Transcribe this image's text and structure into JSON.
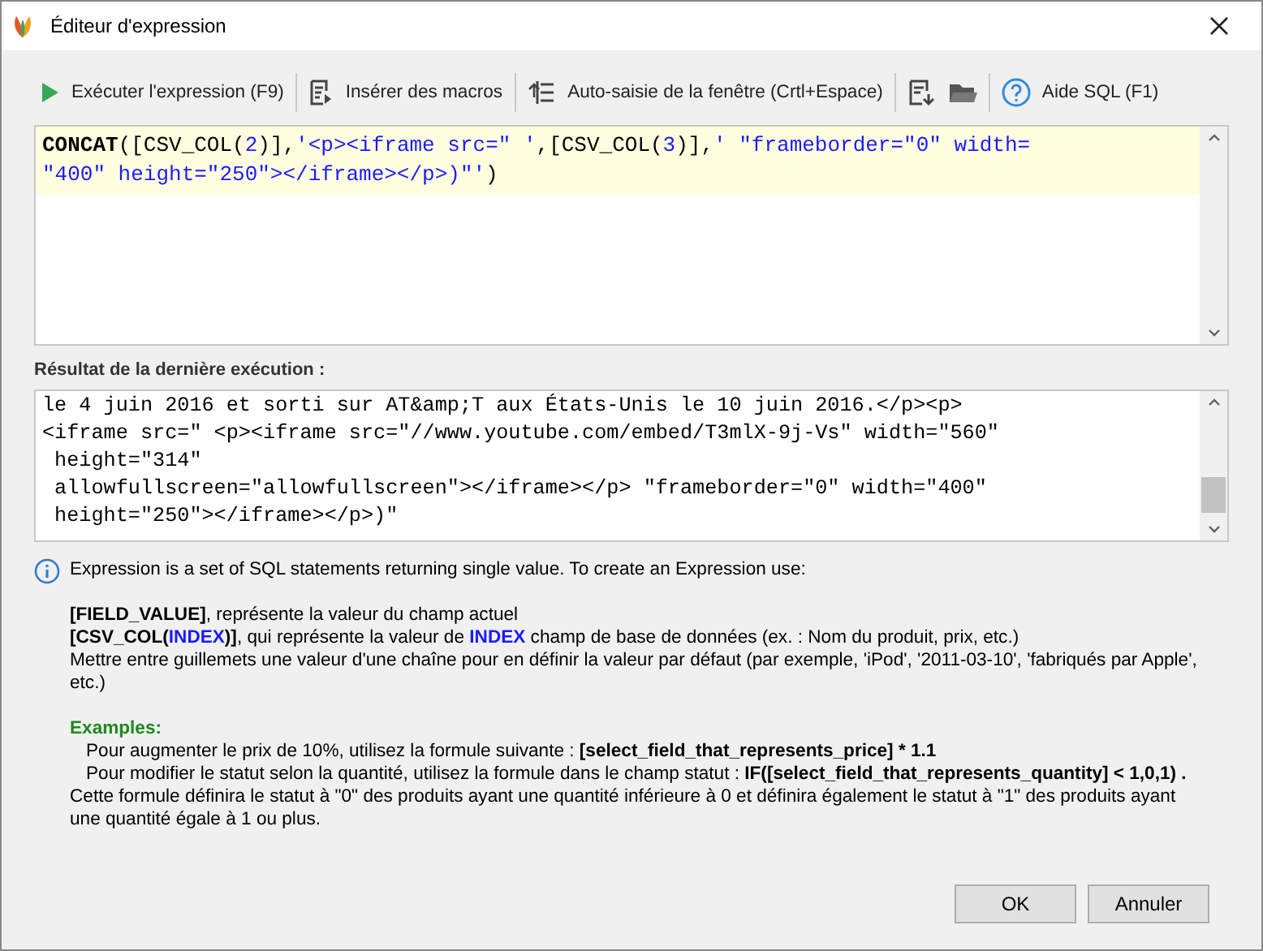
{
  "window": {
    "title": "Éditeur d'expression"
  },
  "toolbar": [
    {
      "kind": "run",
      "label": "Exécuter l'expression (F9)"
    },
    {
      "kind": "macros",
      "label": "Insérer des macros"
    },
    {
      "kind": "autofill",
      "label": "Auto-saisie de la fenêtre (Crtl+Espace)"
    },
    {
      "kind": "save"
    },
    {
      "kind": "open"
    },
    {
      "kind": "help",
      "label": "Aide SQL (F1)"
    }
  ],
  "editor": {
    "lines": [
      [
        {
          "kind": "keyword",
          "text": "CONCAT"
        },
        {
          "kind": "plain",
          "text": "([CSV_COL("
        },
        {
          "kind": "number",
          "text": "2"
        },
        {
          "kind": "plain",
          "text": ")],"
        },
        {
          "kind": "string",
          "text": "'<p><iframe src=\" '"
        },
        {
          "kind": "plain",
          "text": ",[CSV_COL("
        },
        {
          "kind": "number",
          "text": "3"
        },
        {
          "kind": "plain",
          "text": ")],"
        },
        {
          "kind": "string",
          "text": "' \"frameborder=\"0\" width="
        }
      ],
      [
        {
          "kind": "string",
          "text": "\"400\" height=\"250\"></iframe></p>)\"'"
        },
        {
          "kind": "plain",
          "text": ")"
        }
      ]
    ]
  },
  "result": {
    "label": "Résultat de la dernière exécution :",
    "lines": [
      "le 4 juin 2016 et sorti sur AT&amp;T aux États-Unis le 10 juin 2016.</p><p>",
      "<iframe src=\" <p><iframe src=\"//www.youtube.com/embed/T3mlX-9j-Vs\" width=\"560\"",
      " height=\"314\"",
      " allowfullscreen=\"allowfullscreen\"></iframe></p> \"frameborder=\"0\" width=\"400\"",
      " height=\"250\"></iframe></p>)\""
    ]
  },
  "help": {
    "intro": "Expression is a set of SQL statements returning single value. To create an Expression use:",
    "lines": [
      [
        {
          "kind": "bold",
          "text": "[FIELD_VALUE]"
        },
        {
          "kind": "plain",
          "text": ", représente la valeur du champ actuel"
        }
      ],
      [
        {
          "kind": "bold",
          "text": "[CSV_COL("
        },
        {
          "kind": "accent",
          "text": "INDEX"
        },
        {
          "kind": "bold",
          "text": ")]"
        },
        {
          "kind": "plain",
          "text": ", qui représente la valeur de "
        },
        {
          "kind": "accent",
          "text": "INDEX"
        },
        {
          "kind": "plain",
          "text": " champ de base de données (ex. : Nom du produit, prix, etc.)"
        }
      ],
      [
        {
          "kind": "plain",
          "text": "Mettre entre guillemets une valeur d'une chaîne pour en définir la valeur par défaut (par exemple, 'iPod', '2011-03-10', 'fabriqués par Apple', etc.)"
        }
      ]
    ],
    "examples_title": "Examples:",
    "examples": [
      [
        {
          "kind": "plain",
          "text": "Pour augmenter le prix de 10%, utilisez la formule suivante : "
        },
        {
          "kind": "bold",
          "text": "[select_field_that_represents_price] * 1.1"
        }
      ],
      [
        {
          "kind": "plain",
          "text": "Pour modifier le statut selon la quantité, utilisez la formule dans le champ statut : "
        },
        {
          "kind": "bold",
          "text": "IF([select_field_that_represents_quantity] < 1,0,1) ."
        }
      ]
    ],
    "note": "Cette formule définira le statut à \"0\" des produits ayant une quantité inférieure à 0 et définira également le statut à \"1\" des produits ayant une quantité égale à 1 ou plus."
  },
  "buttons": [
    {
      "label": "OK"
    },
    {
      "label": "Annuler"
    }
  ]
}
